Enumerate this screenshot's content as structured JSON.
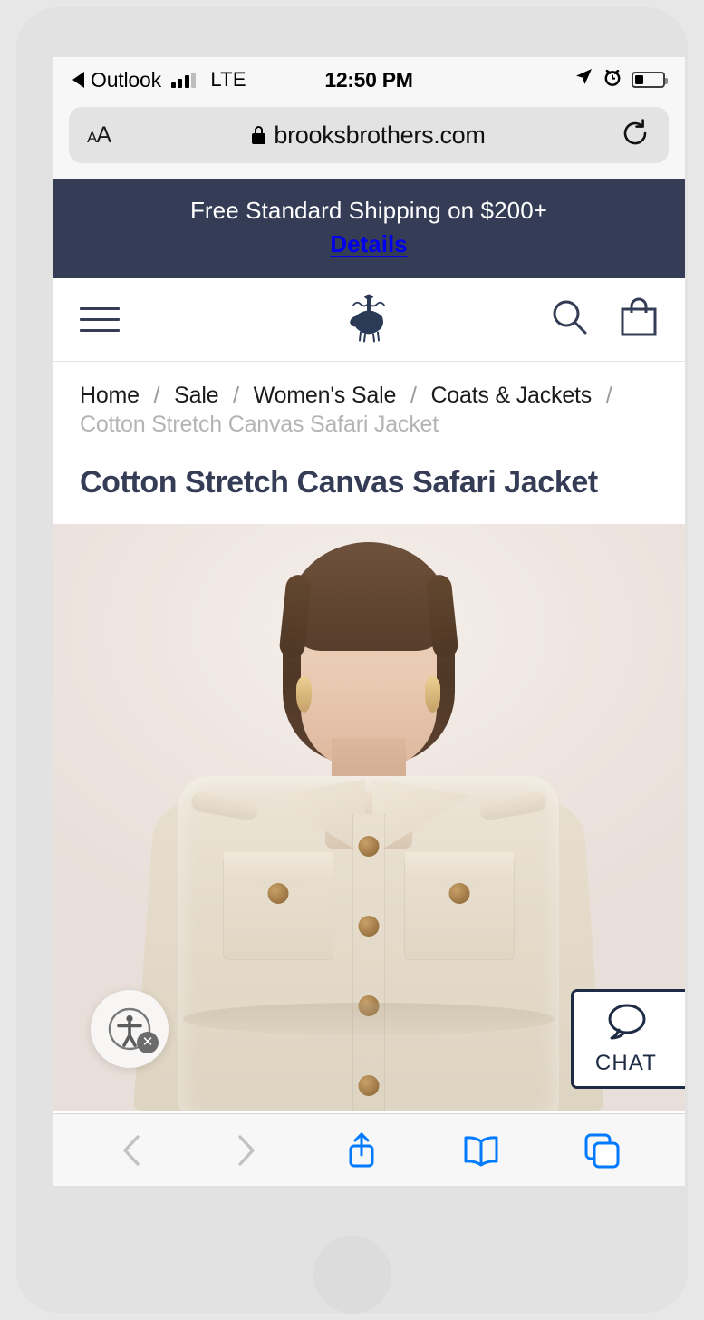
{
  "device": {
    "frame_color": "#e2e2e2",
    "page_background": "#e7e7e7"
  },
  "status_bar": {
    "back_app_label": "Outlook",
    "back_icon": "back-triangle-icon",
    "signal_icon": "cellular-signal-icon",
    "signal_bars_filled": 3,
    "signal_bars_total": 4,
    "carrier": "LTE",
    "time": "12:50 PM",
    "location_icon": "location-arrow-icon",
    "alarm_icon": "alarm-clock-icon",
    "battery_icon": "battery-icon",
    "battery_level_percent": 32
  },
  "browser": {
    "text_size_button": "AA",
    "text_size_button_small": "A",
    "text_size_button_large": "A",
    "lock_icon": "lock-icon",
    "url": "brooksbrothers.com",
    "reload_icon": "reload-icon",
    "toolbar": {
      "back_icon": "chevron-left-icon",
      "back_enabled": false,
      "forward_icon": "chevron-right-icon",
      "forward_enabled": false,
      "share_icon": "share-icon",
      "bookmarks_icon": "book-icon",
      "tabs_icon": "tabs-icon",
      "active_color": "#007aff",
      "disabled_color": "#c2c2c2"
    }
  },
  "promo_banner": {
    "text": "Free Standard Shipping on $200+",
    "link_label": "Details",
    "background": "#343c56",
    "text_color": "#ffffff"
  },
  "site_header": {
    "menu_icon": "hamburger-menu-icon",
    "logo_icon": "brooks-brothers-golden-fleece-logo",
    "search_icon": "search-icon",
    "bag_icon": "shopping-bag-icon",
    "accent_color": "#343c56"
  },
  "breadcrumb": {
    "items": [
      {
        "label": "Home",
        "current": false
      },
      {
        "label": "Sale",
        "current": false
      },
      {
        "label": "Women's Sale",
        "current": false
      },
      {
        "label": "Coats & Jackets",
        "current": false
      },
      {
        "label": "Cotton Stretch Canvas Safari Jacket",
        "current": true
      }
    ],
    "separator": "/"
  },
  "product": {
    "title": "Cotton Stretch Canvas Safari Jacket",
    "image_alt": "Model wearing cream cotton stretch canvas safari jacket",
    "image_background": "#f1eae6"
  },
  "accessibility_widget": {
    "icon": "accessibility-person-icon",
    "close_badge_icon": "close-x-icon",
    "close_badge_label": "✕"
  },
  "chat_widget": {
    "icon": "chat-bubble-icon",
    "label": "CHAT",
    "border_color": "#1d2b44"
  }
}
